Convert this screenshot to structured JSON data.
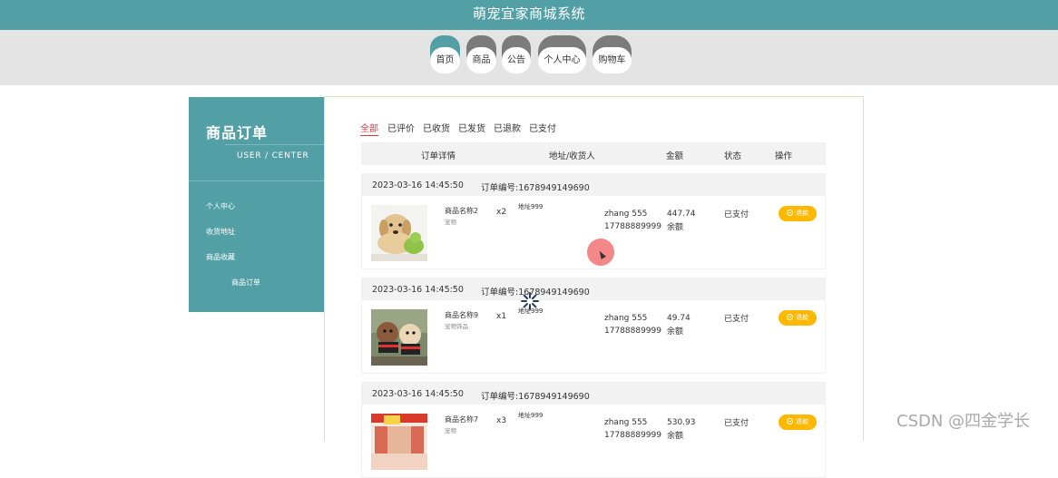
{
  "app": {
    "title": "萌宠宜家商城系统"
  },
  "nav": {
    "items": [
      {
        "label": "首页",
        "active": true
      },
      {
        "label": "商品",
        "active": false
      },
      {
        "label": "公告",
        "active": false
      },
      {
        "label": "个人中心",
        "active": false
      },
      {
        "label": "购物车",
        "active": false
      }
    ]
  },
  "sidebar": {
    "title": "商品订单",
    "subtitle": "USER / CENTER",
    "links": [
      "个人中心",
      "收货地址",
      "商品收藏",
      "商品订单"
    ]
  },
  "tabs": [
    "全部",
    "已评价",
    "已收货",
    "已发货",
    "已退款",
    "已支付"
  ],
  "table": {
    "headers": [
      "订单详情",
      "地址/收货人",
      "金额",
      "状态",
      "操作"
    ]
  },
  "orders": [
    {
      "date": "2023-03-16 14:45:50",
      "order_no": "订单编号:1678949149690",
      "product": "商品名称2",
      "desc": "宠物",
      "qty": "x2",
      "address": "地址999",
      "name": "zhang 555",
      "phone": "17788889999",
      "amount": "447.74",
      "pay": "余额",
      "status": "已支付",
      "action": "退款"
    },
    {
      "date": "2023-03-16 14:45:50",
      "order_no": "订单编号:1678949149690",
      "product": "商品名称9",
      "desc": "宠物饰品",
      "qty": "x1",
      "address": "地址999",
      "name": "zhang 555",
      "phone": "17788889999",
      "amount": "49.74",
      "pay": "余额",
      "status": "已支付",
      "action": "退款"
    },
    {
      "date": "2023-03-16 14:45:50",
      "order_no": "订单编号:1678949149690",
      "product": "商品名称7",
      "desc": "宠物",
      "qty": "x3",
      "address": "地址999",
      "name": "zhang 555",
      "phone": "17788889999",
      "amount": "530.93",
      "pay": "余额",
      "status": "已支付",
      "action": "退款"
    }
  ],
  "watermark": "CSDN @四金学长",
  "colors": {
    "accent": "#539fa6",
    "active_tab": "#e4393c",
    "refund_button": "#ffb800"
  }
}
